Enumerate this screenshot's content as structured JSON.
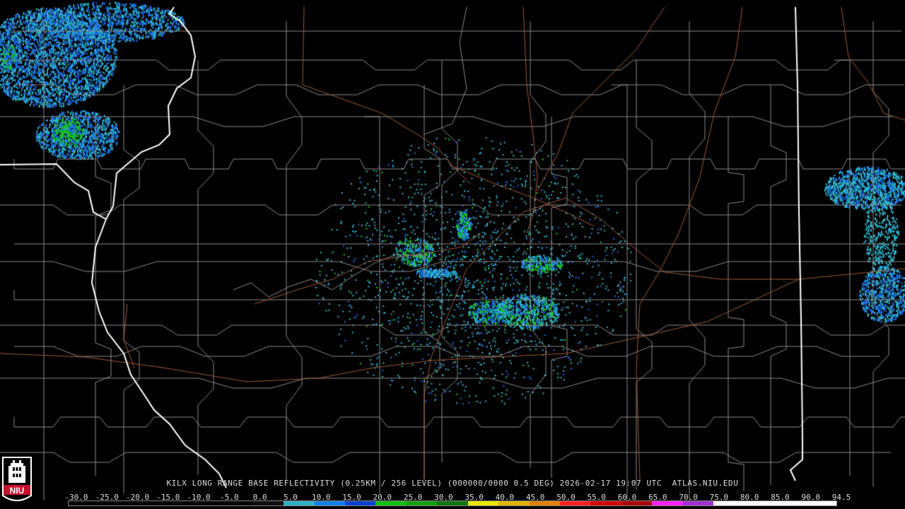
{
  "product": {
    "caption": "KILX LONG RANGE BASE REFLECTIVITY (0.25KM / 256 LEVEL) (000000/0000 0.5 DEG) 2026-02-17 19:07 UTC  ATLAS.NIU.EDU"
  },
  "logo": {
    "text": "NIU",
    "colors": {
      "shield": "#c8102e",
      "tower": "#ffffff",
      "outline": "#ffffff"
    }
  },
  "colorbar": {
    "labels": [
      "-30.0",
      "-25.0",
      "-20.0",
      "-15.0",
      "-10.0",
      "-5.0",
      "0.0",
      "5.0",
      "10.0",
      "15.0",
      "20.0",
      "25.0",
      "30.0",
      "35.0",
      "40.0",
      "45.0",
      "50.0",
      "55.0",
      "60.0",
      "65.0",
      "70.0",
      "75.0",
      "80.0",
      "85.0",
      "90.0",
      "94.5"
    ],
    "colors": [
      "#000000",
      "#000000",
      "#000000",
      "#000000",
      "#000000",
      "#000000",
      "#0f0f0f",
      "#30b0c8",
      "#1080e8",
      "#0040d0",
      "#10c010",
      "#10a010",
      "#107810",
      "#e8e800",
      "#e0b400",
      "#e08000",
      "#ff2020",
      "#d00000",
      "#a80000",
      "#ff20ff",
      "#a030d0",
      "#ffffff",
      "#ffffff",
      "#ffffff",
      "#ffffff"
    ]
  },
  "map_style": {
    "background": "#000000",
    "county_lines": "#8a8a8a",
    "state_lines": "#ffffff",
    "highways": "#a05a32",
    "echo_light": "#30b8d0",
    "echo_medium": "#1a6ee8",
    "echo_heavy": "#18c818"
  }
}
